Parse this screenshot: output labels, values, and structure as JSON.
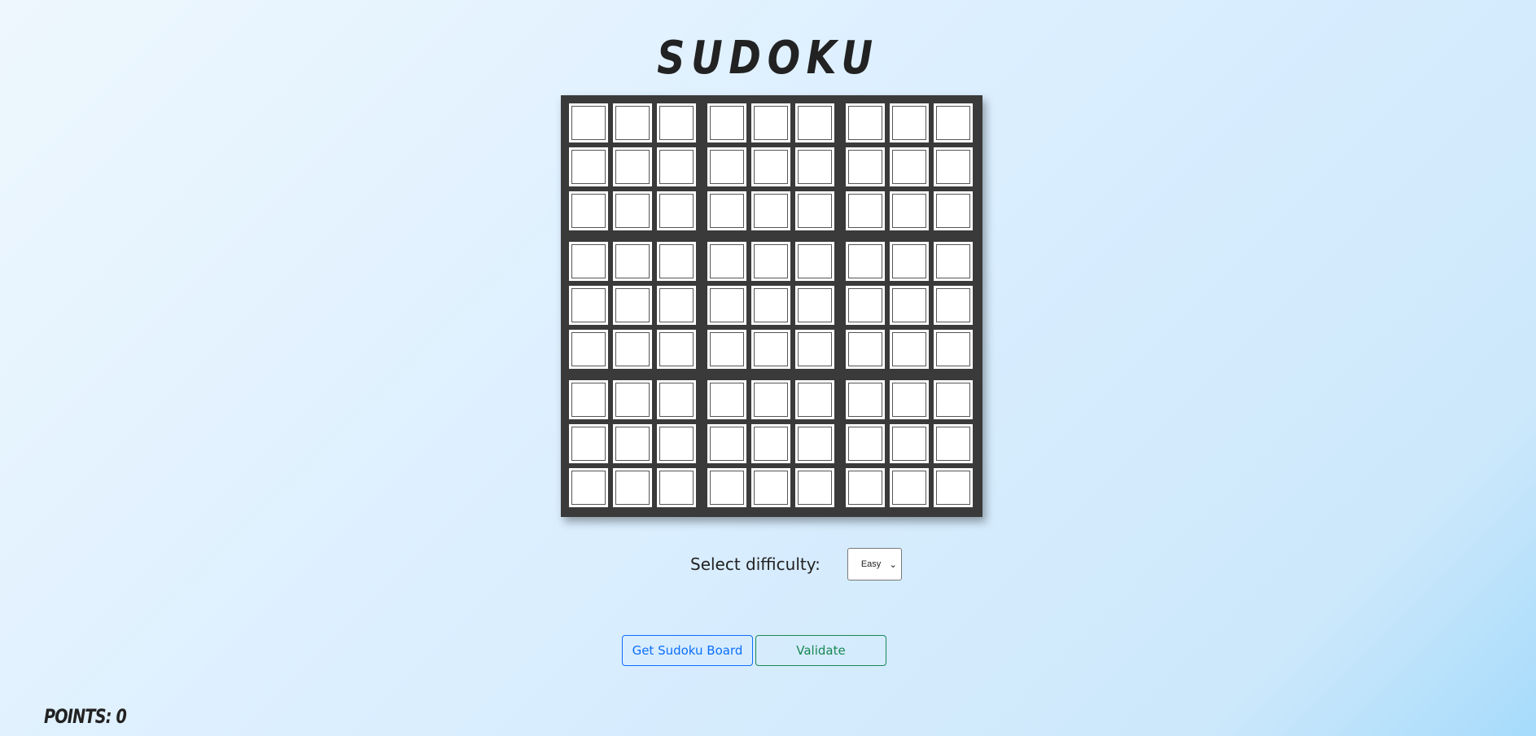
{
  "title": "SUDOKU",
  "board": {
    "rows": 9,
    "cols": 9,
    "cells": [
      [
        "",
        "",
        "",
        "",
        "",
        "",
        "",
        "",
        ""
      ],
      [
        "",
        "",
        "",
        "",
        "",
        "",
        "",
        "",
        ""
      ],
      [
        "",
        "",
        "",
        "",
        "",
        "",
        "",
        "",
        ""
      ],
      [
        "",
        "",
        "",
        "",
        "",
        "",
        "",
        "",
        ""
      ],
      [
        "",
        "",
        "",
        "",
        "",
        "",
        "",
        "",
        ""
      ],
      [
        "",
        "",
        "",
        "",
        "",
        "",
        "",
        "",
        ""
      ],
      [
        "",
        "",
        "",
        "",
        "",
        "",
        "",
        "",
        ""
      ],
      [
        "",
        "",
        "",
        "",
        "",
        "",
        "",
        "",
        ""
      ],
      [
        "",
        "",
        "",
        "",
        "",
        "",
        "",
        "",
        ""
      ]
    ]
  },
  "difficulty": {
    "label": "Select difficulty:",
    "selected": "Easy"
  },
  "buttons": {
    "get_board": "Get Sudoku Board",
    "validate": "Validate"
  },
  "points": "POINTS: 0",
  "colors": {
    "board_bg": "#3a3a3a",
    "get_board_accent": "#0d6efd",
    "validate_accent": "#198754"
  }
}
